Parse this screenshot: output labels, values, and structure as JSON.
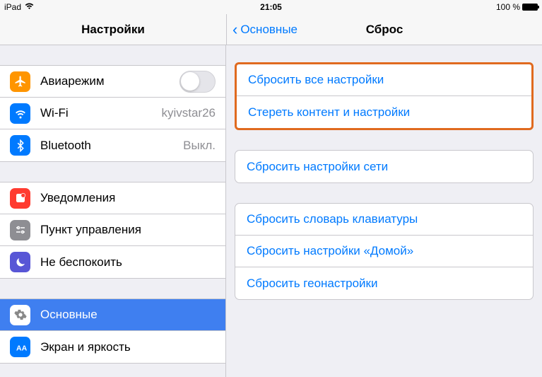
{
  "status": {
    "device": "iPad",
    "time": "21:05",
    "battery_text": "100 %"
  },
  "nav": {
    "left_title": "Настройки",
    "back_label": "Основные",
    "right_title": "Сброс"
  },
  "sidebar": {
    "group1": [
      {
        "label": "Авиарежим",
        "detail": "",
        "toggle": true
      },
      {
        "label": "Wi-Fi",
        "detail": "kyivstar26"
      },
      {
        "label": "Bluetooth",
        "detail": "Выкл."
      }
    ],
    "group2": [
      {
        "label": "Уведомления"
      },
      {
        "label": "Пункт управления"
      },
      {
        "label": "Не беспокоить"
      }
    ],
    "group3": [
      {
        "label": "Основные",
        "selected": true
      },
      {
        "label": "Экран и яркость"
      }
    ]
  },
  "reset": {
    "group1": [
      "Сбросить все настройки",
      "Стереть контент и настройки"
    ],
    "group2": [
      "Сбросить настройки сети"
    ],
    "group3": [
      "Сбросить словарь клавиатуры",
      "Сбросить настройки «Домой»",
      "Сбросить геонастройки"
    ]
  }
}
